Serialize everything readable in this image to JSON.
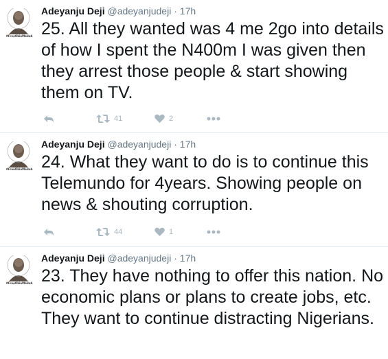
{
  "tweets": [
    {
      "name": "Adeyanju Deji",
      "handle": "@adeyanjudeji",
      "separator": "·",
      "time": "17h",
      "text": "25. All they wanted was 4 me 2go into details of how I spent the N400m I was given then they arrest those people & start showing them on TV.",
      "retweets": "41",
      "likes": "2",
      "avatar_tag": "#FreeObioMaduh"
    },
    {
      "name": "Adeyanju Deji",
      "handle": "@adeyanjudeji",
      "separator": "·",
      "time": "17h",
      "text": "24. What they want to do is to continue this Telemundo for 4years. Showing people on news & shouting corruption.",
      "retweets": "44",
      "likes": "1",
      "avatar_tag": "#FreeObioMaduh"
    },
    {
      "name": "Adeyanju Deji",
      "handle": "@adeyanjudeji",
      "separator": "·",
      "time": "17h",
      "text": "23. They have nothing to offer this nation. No economic plans or plans to create jobs, etc. They want to continue distracting Nigerians.",
      "avatar_tag": "#FreeObioMaduh"
    }
  ],
  "colors": {
    "text": "#14171a",
    "secondary": "#657786",
    "action_icon": "#aab8c2",
    "divider": "#e1e8ed"
  },
  "icons": [
    "reply-icon",
    "retweet-icon",
    "like-icon",
    "more-icon"
  ]
}
